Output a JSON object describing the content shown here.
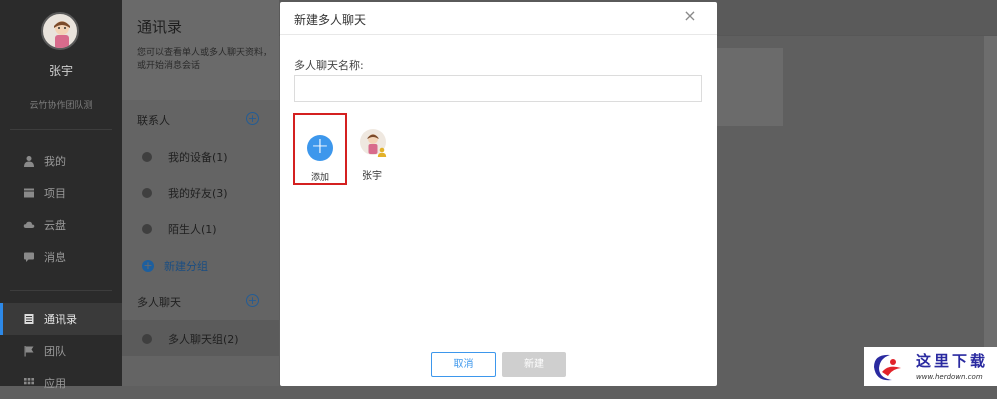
{
  "sidebar": {
    "user_name": "张宇",
    "team_name": "云竹协作团队测",
    "nav": [
      {
        "label": "我的",
        "icon": "person-icon"
      },
      {
        "label": "项目",
        "icon": "project-icon"
      },
      {
        "label": "云盘",
        "icon": "cloud-icon"
      },
      {
        "label": "消息",
        "icon": "message-icon"
      },
      {
        "label": "通讯录",
        "icon": "contacts-icon",
        "active": true
      },
      {
        "label": "团队",
        "icon": "flag-icon"
      },
      {
        "label": "应用",
        "icon": "apps-icon"
      }
    ]
  },
  "contacts": {
    "title": "通讯录",
    "description": "您可以查看单人或多人聊天资料，或开始消息会话",
    "section_contacts": "联系人",
    "items": [
      {
        "label": "我的设备(1)"
      },
      {
        "label": "我的好友(3)"
      },
      {
        "label": "陌生人(1)"
      }
    ],
    "new_group": "新建分组",
    "section_group_chat": "多人聊天",
    "group_item": "多人聊天组(2)",
    "plus": "+"
  },
  "modal": {
    "title": "新建多人聊天",
    "close": "×",
    "name_label": "多人聊天名称:",
    "name_value": "",
    "add_label": "添加",
    "add_symbol": "+",
    "member_name": "张宇",
    "cancel": "取消",
    "create": "新建"
  },
  "watermark": {
    "title": "这里下载",
    "url": "www.herdown.com"
  },
  "colors": {
    "accent": "#3d97ec",
    "highlight_border": "#d42020",
    "active_bar": "#2d89e8"
  }
}
